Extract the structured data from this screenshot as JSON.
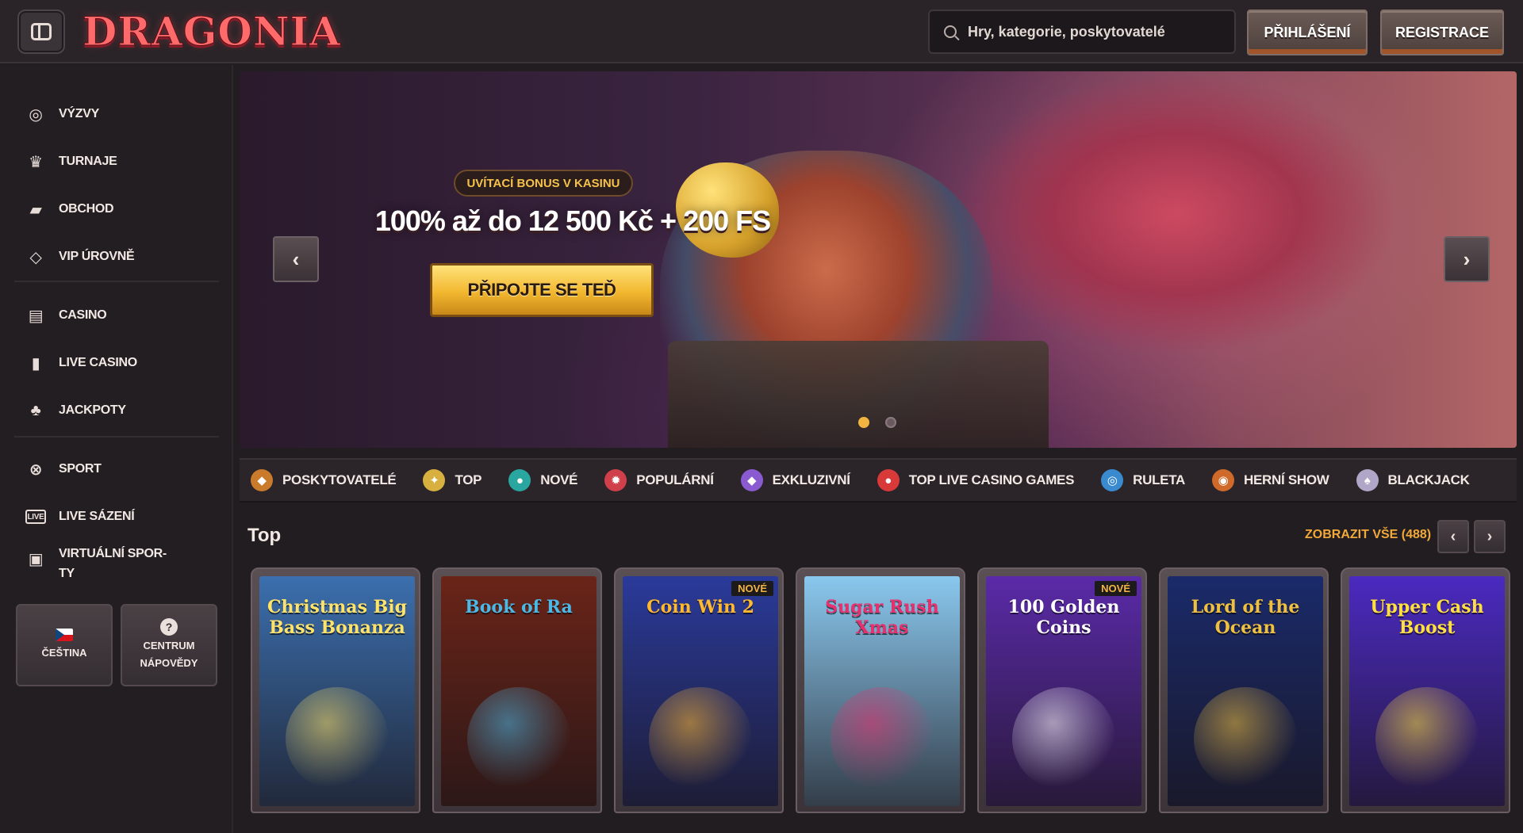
{
  "header": {
    "logo_text": "DRAGONIA",
    "search_placeholder": "Hry, kategorie, poskytovatelé",
    "login_label": "PŘIHLÁŠENÍ",
    "register_label": "REGISTRACE"
  },
  "sidebar": {
    "group1": [
      {
        "label": "VÝZVY",
        "icon": "target-icon"
      },
      {
        "label": "TURNAJE",
        "icon": "trophy-icon"
      },
      {
        "label": "OBCHOD",
        "icon": "basket-icon"
      },
      {
        "label": "VIP ÚROVNĚ",
        "icon": "diamond-icon"
      }
    ],
    "group2": [
      {
        "label": "CASINO",
        "icon": "slot-machine-icon"
      },
      {
        "label": "LIVE CASINO",
        "icon": "card-icon"
      },
      {
        "label": "JACKPOTY",
        "icon": "clover-icon"
      }
    ],
    "group3": [
      {
        "label": "SPORT",
        "icon": "ball-icon"
      },
      {
        "label": "LIVE SÁZENÍ",
        "icon": "live-icon"
      },
      {
        "label": "VIRTUÁLNÍ SPOR-",
        "label2": "TY",
        "icon": "monitor-icon"
      }
    ],
    "language_label": "ČEŠTINA",
    "help_label_1": "CENTRUM",
    "help_label_2": "NÁPOVĚDY",
    "help_icon": "?"
  },
  "hero": {
    "pill": "UVÍTACÍ BONUS V KASINU",
    "title": "100% až do 12 500 Kč + 200 FS",
    "cta": "PŘIPOJTE SE TEĎ",
    "prev": "‹",
    "next": "›"
  },
  "categories": [
    {
      "label": "POSKYTOVATELÉ",
      "icon_color": "#c97a2a",
      "glyph": "◆"
    },
    {
      "label": "TOP",
      "icon_color": "#d8b040",
      "glyph": "✦"
    },
    {
      "label": "NOVÉ",
      "icon_color": "#2aa6a0",
      "glyph": "●"
    },
    {
      "label": "POPULÁRNÍ",
      "icon_color": "#d0404a",
      "glyph": "✹"
    },
    {
      "label": "EXKLUZIVNÍ",
      "icon_color": "#8a5ad0",
      "glyph": "◆"
    },
    {
      "label": "TOP LIVE CASINO GAMES",
      "icon_color": "#d83a3a",
      "glyph": "●"
    },
    {
      "label": "RULETA",
      "icon_color": "#3a8ad0",
      "glyph": "◎"
    },
    {
      "label": "HERNÍ SHOW",
      "icon_color": "#d06a2a",
      "glyph": "◉"
    },
    {
      "label": "BLACKJACK",
      "icon_color": "#b0a6c8",
      "glyph": "♠"
    }
  ],
  "top_section": {
    "title": "Top",
    "show_all": "ZOBRAZIT VŠE (488)",
    "prev": "‹",
    "next": "›"
  },
  "games": [
    {
      "name": "Christmas Big Bass Bonanza",
      "bg": "#3b6fae",
      "fg": "#ffe36a",
      "badge": ""
    },
    {
      "name": "Book of Ra",
      "bg": "#6a2418",
      "fg": "#4bb8e6",
      "badge": ""
    },
    {
      "name": "Coin Win 2",
      "bg": "#2a3a9a",
      "fg": "#ffb830",
      "badge": "NOVÉ"
    },
    {
      "name": "Sugar Rush Xmas",
      "bg": "#8ac8ee",
      "fg": "#e8306e",
      "badge": ""
    },
    {
      "name": "100 Golden Coins",
      "bg": "#5a2aa8",
      "fg": "#ffffff",
      "badge": "NOVÉ"
    },
    {
      "name": "Lord of the Ocean",
      "bg": "#1a2a6a",
      "fg": "#f0c040",
      "badge": ""
    },
    {
      "name": "Upper Cash Boost",
      "bg": "#4a2ac0",
      "fg": "#ffe040",
      "badge": ""
    }
  ]
}
